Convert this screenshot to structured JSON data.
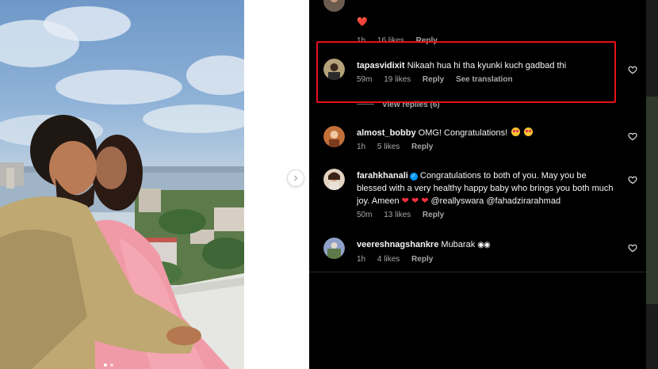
{
  "comments_panel": {
    "top_comment": {
      "username": "",
      "text": "❤️",
      "time": "1h",
      "likes": "16 likes",
      "reply": "Reply"
    },
    "highlighted_comment": {
      "username": "tapasvidixit",
      "text": "Nikaah hua hi tha kyunki kuch gadbad thi",
      "time": "59m",
      "likes": "19 likes",
      "reply": "Reply",
      "see_translation": "See translation"
    },
    "view_replies": "View replies (6)",
    "comments": [
      {
        "username": "almost_bobby",
        "text": "OMG! Congratulations!",
        "time": "1h",
        "likes": "5 likes",
        "reply": "Reply"
      },
      {
        "username": "farahkhanali",
        "verified": true,
        "text": "Congratulations to both of you. May you be blessed with a very healthy happy baby who brings you both much joy. Ameen",
        "mentions": "@reallyswara @fahadzirarahmad",
        "time": "50m",
        "likes": "13 likes",
        "reply": "Reply"
      },
      {
        "username": "veereshnagshankre",
        "text": "Mubarak",
        "time": "1h",
        "likes": "4 likes",
        "reply": "Reply"
      }
    ]
  },
  "icons": {
    "like": "heart-outline-icon",
    "carousel": "chevron-right-icon",
    "verified": "verified-badge-icon"
  },
  "colors": {
    "panel_bg": "#000000",
    "highlight_border": "#e8101c",
    "heart_emoji": "#ff3040",
    "verified": "#0095f6",
    "meta_text": "#a8a8a8"
  }
}
